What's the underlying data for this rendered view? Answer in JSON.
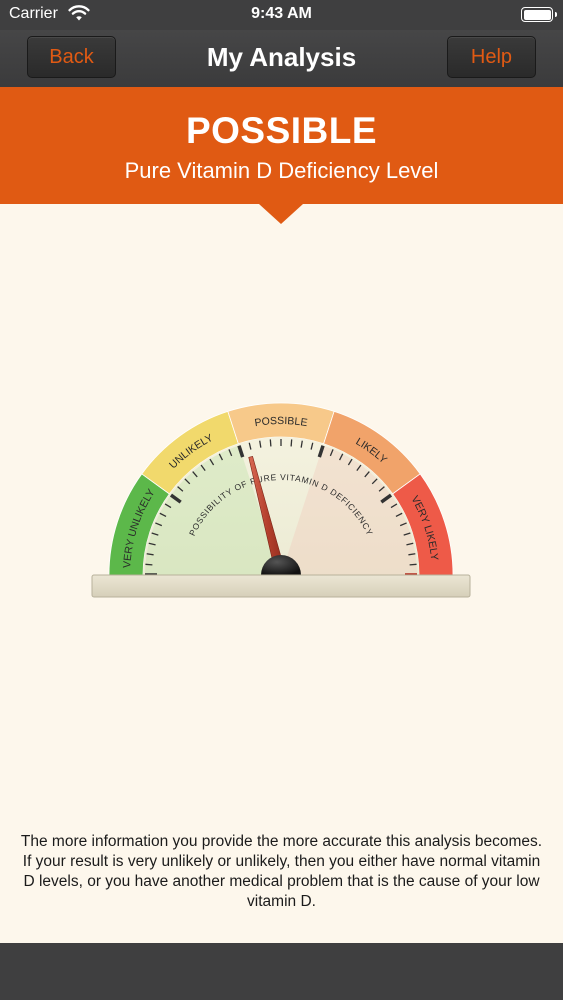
{
  "status_bar": {
    "carrier": "Carrier",
    "time": "9:43 AM"
  },
  "nav": {
    "title": "My Analysis",
    "back_label": "Back",
    "help_label": "Help"
  },
  "result": {
    "level": "POSSIBLE",
    "subtitle": "Pure Vitamin D Deficiency Level"
  },
  "gauge": {
    "inner_label": "POSSIBILITY OF PURE VITAMIN D DEFICIENCY",
    "segments": [
      {
        "label": "VERY UNLIKELY",
        "color": "#5cb84a"
      },
      {
        "label": "UNLIKELY",
        "color": "#f1d96c"
      },
      {
        "label": "POSSIBLE",
        "color": "#f7c98a"
      },
      {
        "label": "LIKELY",
        "color": "#f1a36a"
      },
      {
        "label": "VERY LIKELY",
        "color": "#ee5a48"
      }
    ],
    "needle_fraction": 0.42
  },
  "info_text": "The more information you provide the more accurate this analysis becomes. If your result is very unlikely or unlikely, then you either have normal vitamin D levels, or you have another medical problem that is the cause of your low vitamin D.",
  "colors": {
    "accent": "#e05a13",
    "bar": "#3f3f40",
    "background": "#fdf7ec"
  }
}
